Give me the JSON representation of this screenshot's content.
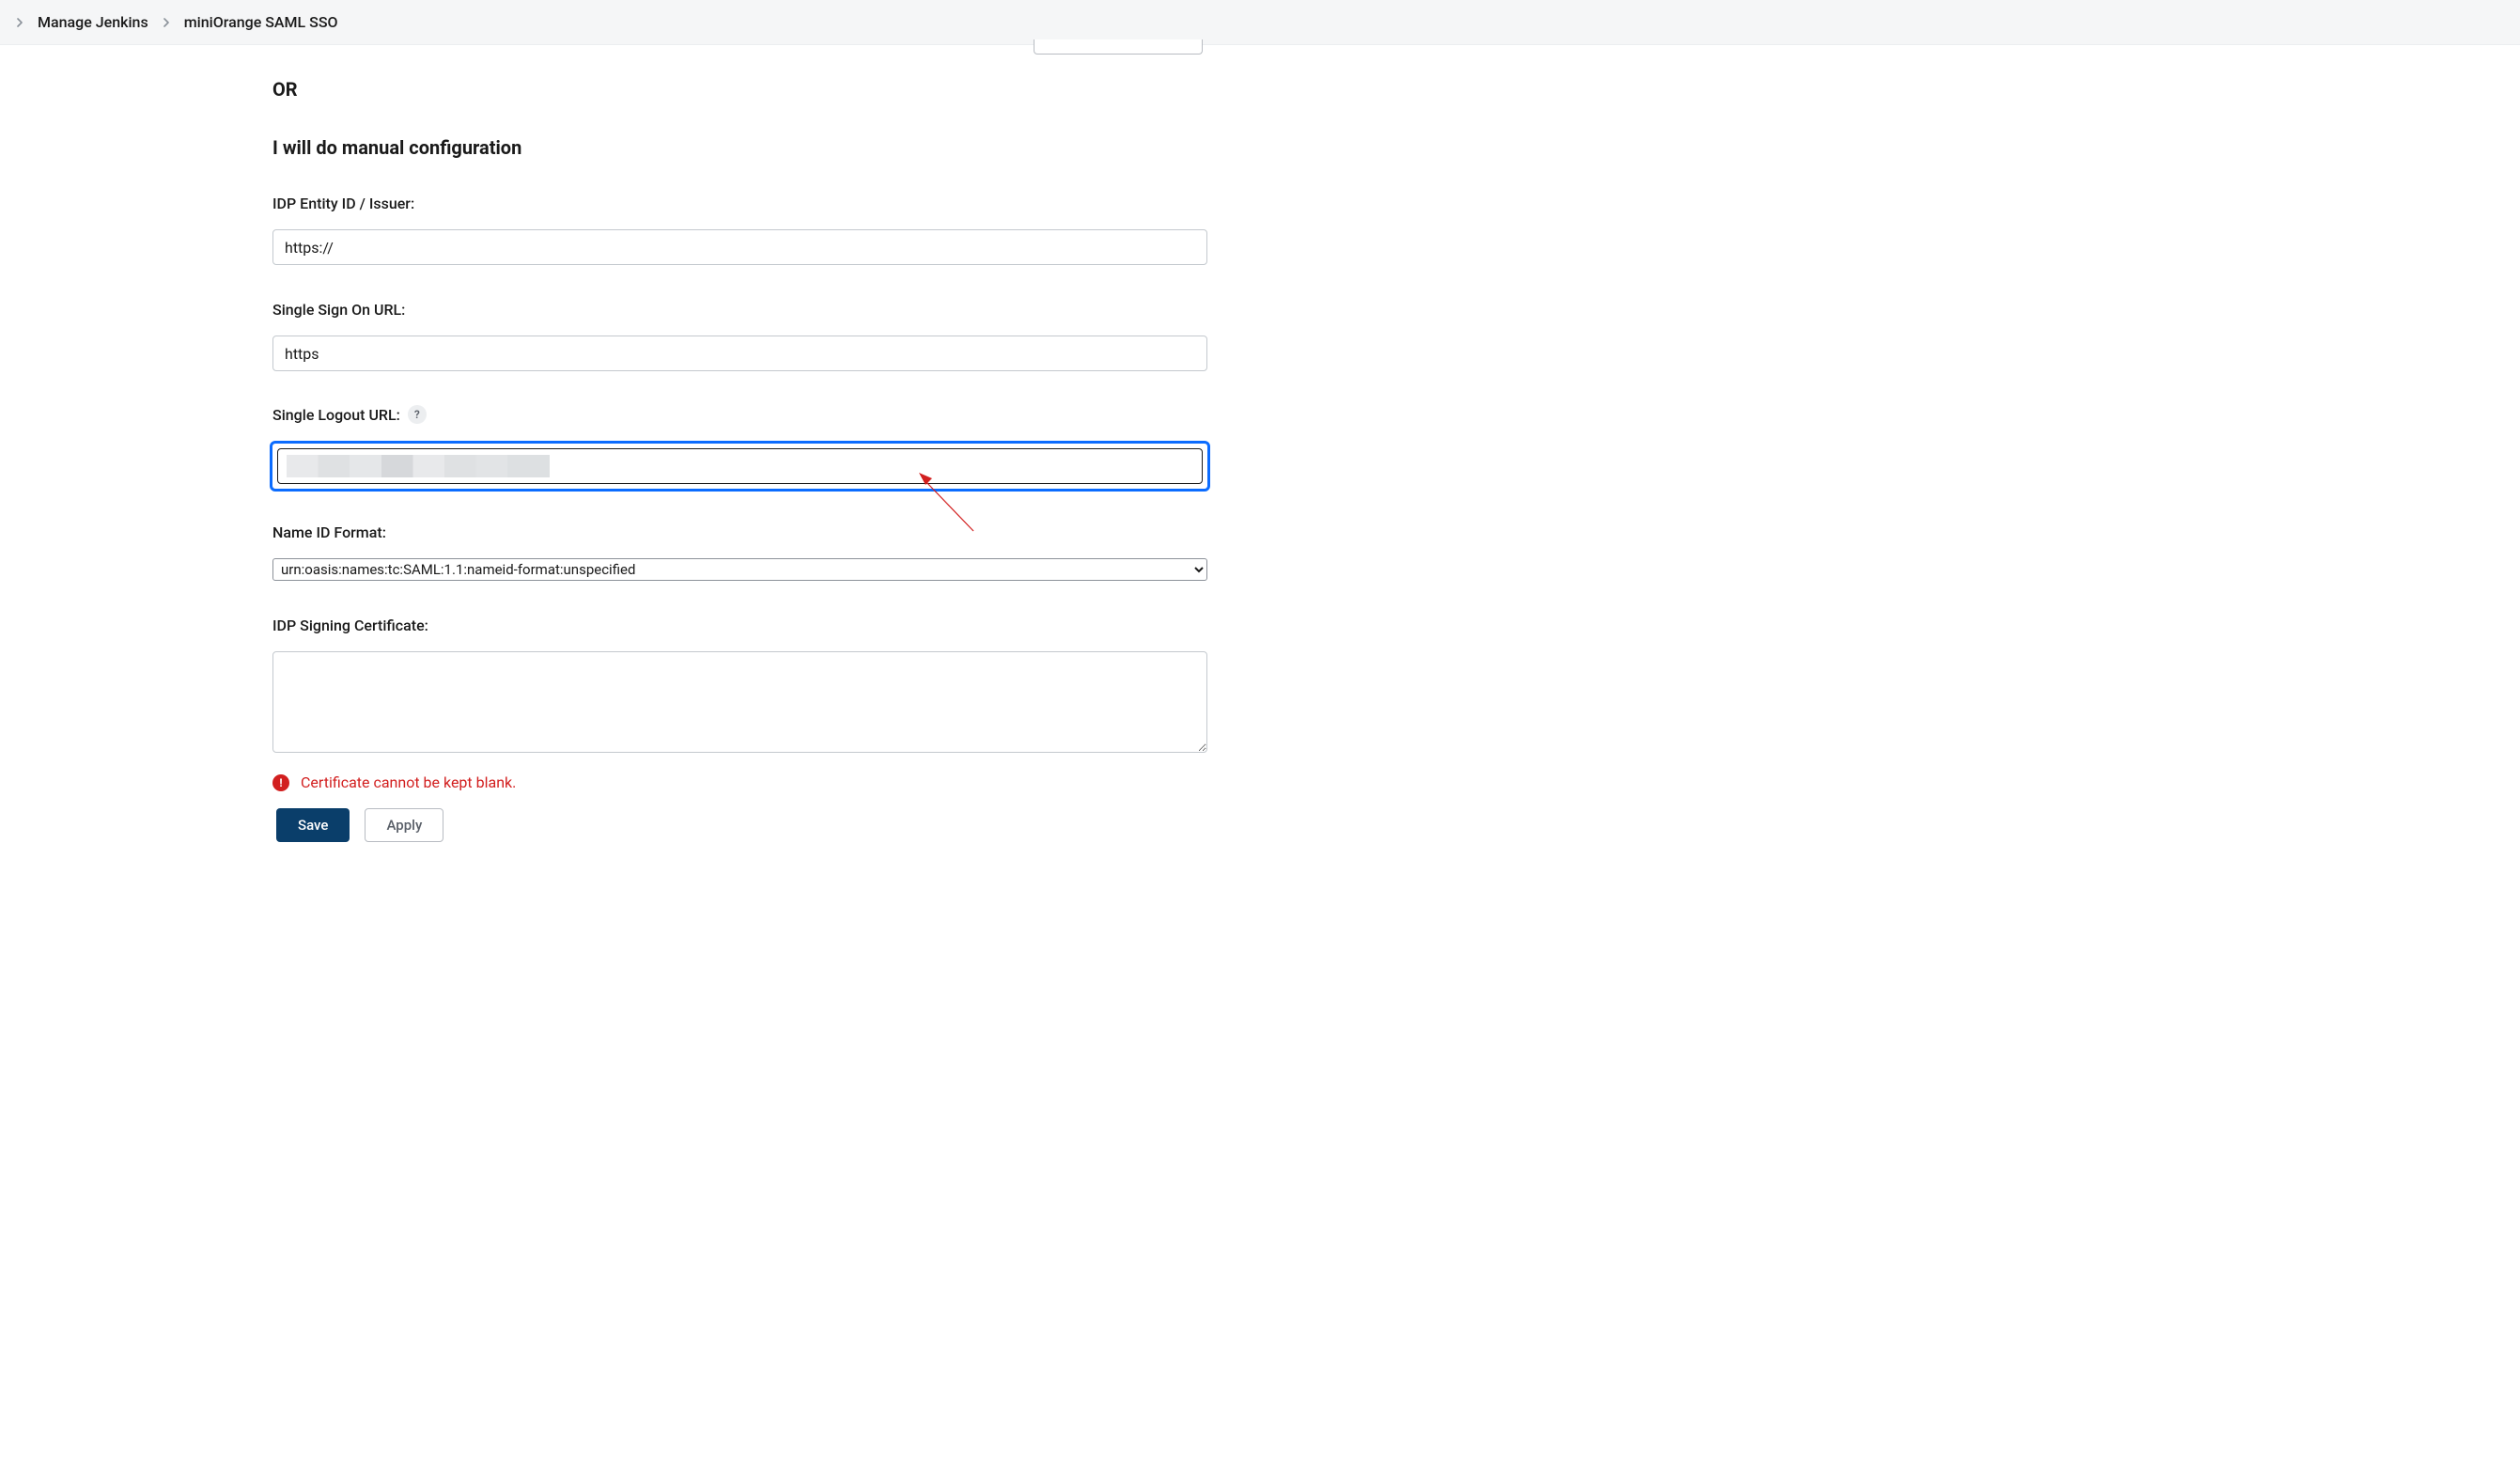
{
  "breadcrumb": {
    "items": [
      {
        "label": "Manage Jenkins"
      },
      {
        "label": "miniOrange SAML SSO"
      }
    ]
  },
  "section": {
    "or_label": "OR",
    "manual_title": "I will do manual configuration"
  },
  "fields": {
    "idp_entity": {
      "label": "IDP Entity ID / Issuer:",
      "value": "https://"
    },
    "sso_url": {
      "label": "Single Sign On URL:",
      "value": "https"
    },
    "slo_url": {
      "label": "Single Logout URL:",
      "help": "?",
      "value": ""
    },
    "nameid": {
      "label": "Name ID Format:",
      "value": "urn:oasis:names:tc:SAML:1.1:nameid-format:unspecified"
    },
    "cert": {
      "label": "IDP Signing Certificate:",
      "value": ""
    }
  },
  "error": {
    "glyph": "!",
    "message": "Certificate cannot be kept blank."
  },
  "buttons": {
    "save": "Save",
    "apply": "Apply"
  }
}
